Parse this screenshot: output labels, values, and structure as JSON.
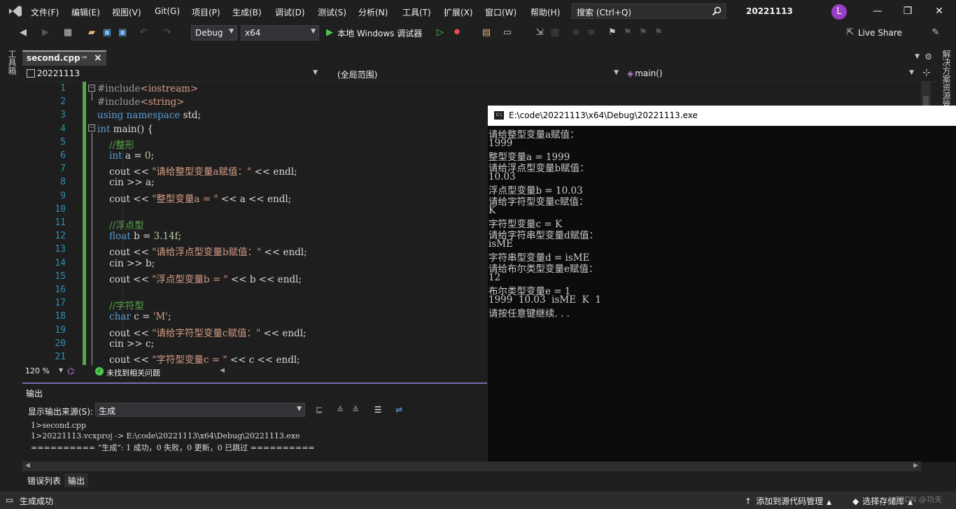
{
  "menubar": {
    "items": [
      "文件(F)",
      "编辑(E)",
      "视图(V)",
      "Git(G)",
      "项目(P)",
      "生成(B)",
      "调试(D)",
      "测试(S)",
      "分析(N)",
      "工具(T)",
      "扩展(X)",
      "窗口(W)",
      "帮助(H)"
    ],
    "search_placeholder": "搜索 (Ctrl+Q)",
    "solution_name": "20221113",
    "avatar_letter": "L"
  },
  "toolbar": {
    "config": "Debug",
    "platform": "x64",
    "run_label": "本地 Windows 调试器",
    "live_share": "Live Share"
  },
  "left_rail": {
    "label": "工具箱"
  },
  "right_rail": {
    "label": "解决方案资源管理器"
  },
  "tab": {
    "file_name": "second.cpp"
  },
  "navbar": {
    "project": "20221113",
    "scope": "(全局范围)",
    "member": "main()"
  },
  "editor": {
    "line_numbers": [
      "1",
      "2",
      "3",
      "4",
      "5",
      "6",
      "7",
      "8",
      "9",
      "10",
      "11",
      "12",
      "13",
      "14",
      "15",
      "16",
      "17",
      "18",
      "19",
      "20",
      "21"
    ],
    "lines": [
      {
        "p": [
          [
            "pp",
            "#include"
          ],
          [
            "str",
            "<iostream>"
          ]
        ]
      },
      {
        "p": [
          [
            "pp",
            "#include"
          ],
          [
            "str",
            "<string>"
          ]
        ]
      },
      {
        "p": [
          [
            "kw",
            "using"
          ],
          [
            "ident",
            " "
          ],
          [
            "kw",
            "namespace"
          ],
          [
            "ident",
            " std;"
          ]
        ]
      },
      {
        "p": [
          [
            "kw",
            "int"
          ],
          [
            "ident",
            " main() {"
          ]
        ]
      },
      {
        "p": [
          [
            "ident",
            "    "
          ],
          [
            "cmt",
            "//整形"
          ]
        ]
      },
      {
        "p": [
          [
            "ident",
            "    "
          ],
          [
            "kw",
            "int"
          ],
          [
            "ident",
            " a = "
          ],
          [
            "num",
            "0"
          ],
          [
            "ident",
            ";"
          ]
        ]
      },
      {
        "p": [
          [
            "ident",
            "    cout << "
          ],
          [
            "str",
            "\"请给整型变量a赋值：\""
          ],
          [
            "ident",
            " << endl;"
          ]
        ]
      },
      {
        "p": [
          [
            "ident",
            "    cin >> a;"
          ]
        ]
      },
      {
        "p": [
          [
            "ident",
            "    cout << "
          ],
          [
            "str",
            "\"整型变量a = \""
          ],
          [
            "ident",
            " << a << endl;"
          ]
        ]
      },
      {
        "p": [
          [
            "ident",
            ""
          ]
        ]
      },
      {
        "p": [
          [
            "ident",
            "    "
          ],
          [
            "cmt",
            "//浮点型"
          ]
        ]
      },
      {
        "p": [
          [
            "ident",
            "    "
          ],
          [
            "kw",
            "float"
          ],
          [
            "ident",
            " b = "
          ],
          [
            "num",
            "3.14f"
          ],
          [
            "ident",
            ";"
          ]
        ]
      },
      {
        "p": [
          [
            "ident",
            "    cout << "
          ],
          [
            "str",
            "\"请给浮点型变量b赋值：\""
          ],
          [
            "ident",
            " << endl;"
          ]
        ]
      },
      {
        "p": [
          [
            "ident",
            "    cin >> b;"
          ]
        ]
      },
      {
        "p": [
          [
            "ident",
            "    cout << "
          ],
          [
            "str",
            "\"浮点型变量b = \""
          ],
          [
            "ident",
            " << b << endl;"
          ]
        ]
      },
      {
        "p": [
          [
            "ident",
            ""
          ]
        ]
      },
      {
        "p": [
          [
            "ident",
            "    "
          ],
          [
            "cmt",
            "//字符型"
          ]
        ]
      },
      {
        "p": [
          [
            "ident",
            "    "
          ],
          [
            "kw",
            "char"
          ],
          [
            "ident",
            " c = "
          ],
          [
            "str",
            "'M'"
          ],
          [
            "ident",
            ";"
          ]
        ]
      },
      {
        "p": [
          [
            "ident",
            "    cout << "
          ],
          [
            "str",
            "\"请给字符型变量c赋值：\""
          ],
          [
            "ident",
            " << endl;"
          ]
        ]
      },
      {
        "p": [
          [
            "ident",
            "    cin >> c;"
          ]
        ]
      },
      {
        "p": [
          [
            "ident",
            "    cout << "
          ],
          [
            "str",
            "\"字符型变量c = \""
          ],
          [
            "ident",
            " << c << endl;"
          ]
        ]
      }
    ],
    "zoom": "120 %",
    "issues": "未找到相关问题"
  },
  "console": {
    "title": "E:\\code\\20221113\\x64\\Debug\\20221113.exe",
    "lines": [
      "请给整型变量a赋值：",
      "1999",
      "整型变量a = 1999",
      "请给浮点型变量b赋值：",
      "10.03",
      "浮点型变量b = 10.03",
      "请给字符型变量c赋值：",
      "K",
      "字符型变量c = K",
      "请给字符串型变量d赋值：",
      "isME",
      "字符串型变量d = isME",
      "请给布尔类型变量e赋值：",
      "12",
      "布尔类型变量e = 1",
      "1999  10.03  isME  K  1",
      "请按任意键继续. . ."
    ]
  },
  "output": {
    "title": "输出",
    "source_label": "显示输出来源(S):",
    "source_value": "生成",
    "lines": [
      "1>second.cpp",
      "1>20221113.vcxproj -> E:\\code\\20221113\\x64\\Debug\\20221113.exe",
      "========== “生成”: 1 成功，0 失败，0 更新，0 已跳过 =========="
    ]
  },
  "bottom_tabs": {
    "errors": "错误列表",
    "output": "输出"
  },
  "statusbar": {
    "status": "生成成功",
    "add_source_control": "添加到源代码管理",
    "select_repo": "选择存储库"
  },
  "watermark": "CSDN @功夫"
}
